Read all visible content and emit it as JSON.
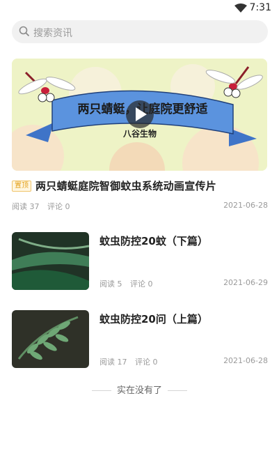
{
  "status": {
    "time": "7:31"
  },
  "search": {
    "placeholder": "搜索资讯"
  },
  "featured": {
    "badge": "置顶",
    "title": "两只蜻蜓庭院智御蚊虫系统动画宣传片",
    "banner_text": "两只蜻蜓，让庭院更舒适",
    "banner_brand": "八谷生物",
    "reads": "阅读 37",
    "comments": "评论 0",
    "date": "2021-06-28"
  },
  "articles": [
    {
      "title": "蚊虫防控20蚊（下篇）",
      "reads": "阅读 5",
      "comments": "评论 0",
      "date": "2021-06-29"
    },
    {
      "title": "蚊虫防控20问（上篇）",
      "reads": "阅读 17",
      "comments": "评论 0",
      "date": "2021-06-28"
    }
  ],
  "footer": {
    "end_text": "实在没有了"
  },
  "colors": {
    "badge": "#e3a11c",
    "search_bg": "#f1f1f1",
    "hero_bg": "#eef3c6"
  },
  "icons": {
    "search": "search-icon",
    "wifi": "wifi-icon",
    "play": "play-icon"
  }
}
